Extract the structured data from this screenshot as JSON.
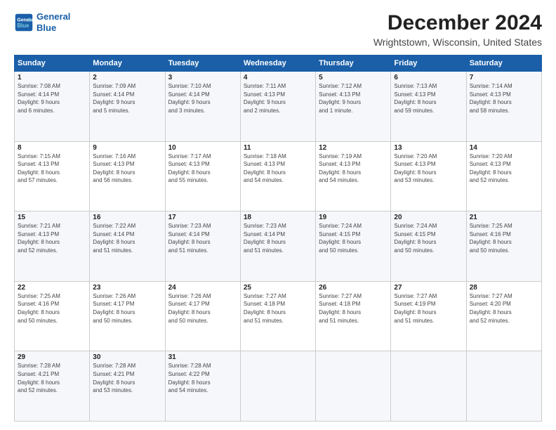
{
  "header": {
    "logo_line1": "General",
    "logo_line2": "Blue",
    "title": "December 2024",
    "subtitle": "Wrightstown, Wisconsin, United States"
  },
  "columns": [
    "Sunday",
    "Monday",
    "Tuesday",
    "Wednesday",
    "Thursday",
    "Friday",
    "Saturday"
  ],
  "weeks": [
    [
      {
        "day": "1",
        "info": "Sunrise: 7:08 AM\nSunset: 4:14 PM\nDaylight: 9 hours\nand 6 minutes."
      },
      {
        "day": "2",
        "info": "Sunrise: 7:09 AM\nSunset: 4:14 PM\nDaylight: 9 hours\nand 5 minutes."
      },
      {
        "day": "3",
        "info": "Sunrise: 7:10 AM\nSunset: 4:14 PM\nDaylight: 9 hours\nand 3 minutes."
      },
      {
        "day": "4",
        "info": "Sunrise: 7:11 AM\nSunset: 4:13 PM\nDaylight: 9 hours\nand 2 minutes."
      },
      {
        "day": "5",
        "info": "Sunrise: 7:12 AM\nSunset: 4:13 PM\nDaylight: 9 hours\nand 1 minute."
      },
      {
        "day": "6",
        "info": "Sunrise: 7:13 AM\nSunset: 4:13 PM\nDaylight: 8 hours\nand 59 minutes."
      },
      {
        "day": "7",
        "info": "Sunrise: 7:14 AM\nSunset: 4:13 PM\nDaylight: 8 hours\nand 58 minutes."
      }
    ],
    [
      {
        "day": "8",
        "info": "Sunrise: 7:15 AM\nSunset: 4:13 PM\nDaylight: 8 hours\nand 57 minutes."
      },
      {
        "day": "9",
        "info": "Sunrise: 7:16 AM\nSunset: 4:13 PM\nDaylight: 8 hours\nand 56 minutes."
      },
      {
        "day": "10",
        "info": "Sunrise: 7:17 AM\nSunset: 4:13 PM\nDaylight: 8 hours\nand 55 minutes."
      },
      {
        "day": "11",
        "info": "Sunrise: 7:18 AM\nSunset: 4:13 PM\nDaylight: 8 hours\nand 54 minutes."
      },
      {
        "day": "12",
        "info": "Sunrise: 7:19 AM\nSunset: 4:13 PM\nDaylight: 8 hours\nand 54 minutes."
      },
      {
        "day": "13",
        "info": "Sunrise: 7:20 AM\nSunset: 4:13 PM\nDaylight: 8 hours\nand 53 minutes."
      },
      {
        "day": "14",
        "info": "Sunrise: 7:20 AM\nSunset: 4:13 PM\nDaylight: 8 hours\nand 52 minutes."
      }
    ],
    [
      {
        "day": "15",
        "info": "Sunrise: 7:21 AM\nSunset: 4:13 PM\nDaylight: 8 hours\nand 52 minutes."
      },
      {
        "day": "16",
        "info": "Sunrise: 7:22 AM\nSunset: 4:14 PM\nDaylight: 8 hours\nand 51 minutes."
      },
      {
        "day": "17",
        "info": "Sunrise: 7:23 AM\nSunset: 4:14 PM\nDaylight: 8 hours\nand 51 minutes."
      },
      {
        "day": "18",
        "info": "Sunrise: 7:23 AM\nSunset: 4:14 PM\nDaylight: 8 hours\nand 51 minutes."
      },
      {
        "day": "19",
        "info": "Sunrise: 7:24 AM\nSunset: 4:15 PM\nDaylight: 8 hours\nand 50 minutes."
      },
      {
        "day": "20",
        "info": "Sunrise: 7:24 AM\nSunset: 4:15 PM\nDaylight: 8 hours\nand 50 minutes."
      },
      {
        "day": "21",
        "info": "Sunrise: 7:25 AM\nSunset: 4:16 PM\nDaylight: 8 hours\nand 50 minutes."
      }
    ],
    [
      {
        "day": "22",
        "info": "Sunrise: 7:25 AM\nSunset: 4:16 PM\nDaylight: 8 hours\nand 50 minutes."
      },
      {
        "day": "23",
        "info": "Sunrise: 7:26 AM\nSunset: 4:17 PM\nDaylight: 8 hours\nand 50 minutes."
      },
      {
        "day": "24",
        "info": "Sunrise: 7:26 AM\nSunset: 4:17 PM\nDaylight: 8 hours\nand 50 minutes."
      },
      {
        "day": "25",
        "info": "Sunrise: 7:27 AM\nSunset: 4:18 PM\nDaylight: 8 hours\nand 51 minutes."
      },
      {
        "day": "26",
        "info": "Sunrise: 7:27 AM\nSunset: 4:18 PM\nDaylight: 8 hours\nand 51 minutes."
      },
      {
        "day": "27",
        "info": "Sunrise: 7:27 AM\nSunset: 4:19 PM\nDaylight: 8 hours\nand 51 minutes."
      },
      {
        "day": "28",
        "info": "Sunrise: 7:27 AM\nSunset: 4:20 PM\nDaylight: 8 hours\nand 52 minutes."
      }
    ],
    [
      {
        "day": "29",
        "info": "Sunrise: 7:28 AM\nSunset: 4:21 PM\nDaylight: 8 hours\nand 52 minutes."
      },
      {
        "day": "30",
        "info": "Sunrise: 7:28 AM\nSunset: 4:21 PM\nDaylight: 8 hours\nand 53 minutes."
      },
      {
        "day": "31",
        "info": "Sunrise: 7:28 AM\nSunset: 4:22 PM\nDaylight: 8 hours\nand 54 minutes."
      },
      {
        "day": "",
        "info": ""
      },
      {
        "day": "",
        "info": ""
      },
      {
        "day": "",
        "info": ""
      },
      {
        "day": "",
        "info": ""
      }
    ]
  ]
}
